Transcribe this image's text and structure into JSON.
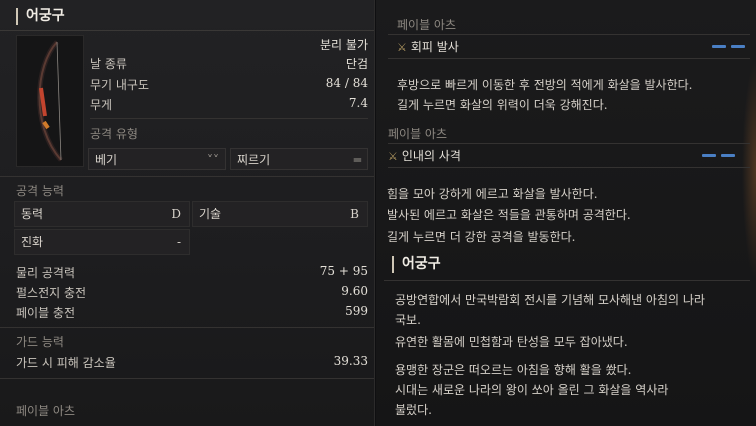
{
  "item": {
    "name": "어궁구",
    "separable": "분리 불가",
    "blade_type": {
      "label": "날 종류",
      "value": "단검"
    },
    "durability": {
      "label": "무기 내구도",
      "value": "84 / 84"
    },
    "weight": {
      "label": "무게",
      "value": "7.4"
    },
    "attack_type": {
      "label": "공격 유형",
      "options": [
        {
          "label": "베기",
          "icon": "double-chevron-down-icon"
        },
        {
          "label": "찌르기",
          "icon": "equals-icon"
        }
      ]
    }
  },
  "attack_ability": {
    "label": "공격 능력",
    "stats": [
      {
        "label": "동력",
        "grade": "D"
      },
      {
        "label": "기술",
        "grade": "B"
      },
      {
        "label": "진화",
        "grade": "-"
      }
    ]
  },
  "combat": {
    "physical_attack": {
      "label": "물리 공격력",
      "value": "75 + 95"
    },
    "pulse_charge": {
      "label": "펄스전지 충전",
      "value": "9.60"
    },
    "fable_charge": {
      "label": "페이블 충전",
      "value": "599"
    }
  },
  "guard": {
    "label": "가드 능력",
    "reduction": {
      "label": "가드 시 피해 감소율",
      "value": "39.33"
    }
  },
  "left_fable_arts": {
    "label": "페이블 아츠"
  },
  "fable_arts": [
    {
      "section_label": "페이블 아츠",
      "name": "회피 발사",
      "icon": "crossed-swords-icon",
      "gauge_segments": 2,
      "description": [
        "후방으로 빠르게 이동한 후 전방의 적에게 화살을 발사한다.",
        "길게 누르면 화살의 위력이 더욱 강해진다."
      ]
    },
    {
      "section_label": "페이블 아츠",
      "name": "인내의 사격",
      "icon": "crossed-swords-icon",
      "gauge_segments": 2,
      "description": [
        "힘을 모아 강하게 에르고 화살을 발사한다.",
        "발사된 에르고 화살은 적들을 관통하며 공격한다.",
        "길게 누르면 더 강한 공격을 발동한다."
      ]
    }
  ],
  "lore": {
    "title": "어궁구",
    "paragraphs": [
      [
        "공방연합에서 만국박람회 전시를 기념해 모사해낸 아침의 나라",
        "국보."
      ],
      [
        "유연한 활몸에 민첩함과 탄성을 모두 잡아냈다."
      ],
      [
        "용맹한 장군은 떠오르는 아침을 향해 활을 쐈다.",
        "시대는 새로운 나라의 왕이 쏘아 올린 그 화살을 역사라",
        "불렀다."
      ]
    ]
  },
  "colors": {
    "gauge": "#4a7fc4",
    "accent": "#b39a62"
  }
}
